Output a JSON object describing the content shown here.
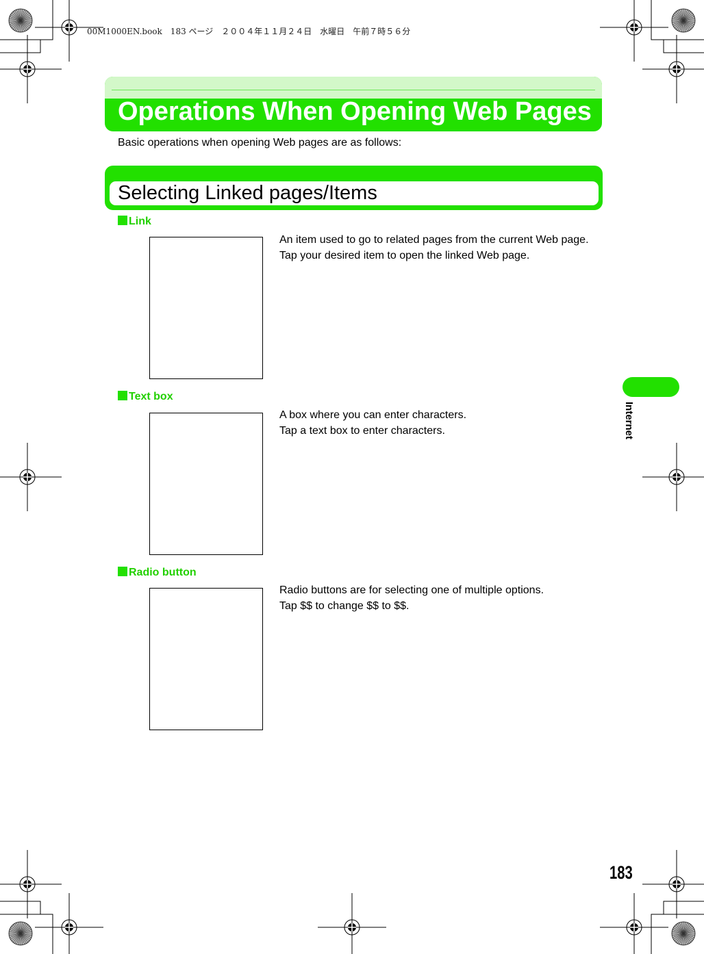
{
  "print_header": "00M1000EN.book　183 ページ　２００４年１１月２４日　水曜日　午前７時５６分",
  "title": "Operations When Opening Web Pages",
  "intro": "Basic operations when opening Web pages are as follows:",
  "section_title": "Selecting Linked pages/Items",
  "items": [
    {
      "heading": "Link",
      "lines": [
        "An item used to go to related pages from the current Web page.",
        "Tap your desired item to open the linked Web page."
      ]
    },
    {
      "heading": "Text box",
      "lines": [
        "A box where you can enter characters.",
        "Tap a text box to enter characters."
      ]
    },
    {
      "heading": "Radio button",
      "lines": [
        "Radio buttons are for selecting one of multiple options.",
        "Tap $$ to change $$ to $$."
      ]
    }
  ],
  "side_tab": "Internet",
  "page_number": "183",
  "colors": {
    "accent": "#22e000",
    "accent_light": "#d3f8c9"
  }
}
